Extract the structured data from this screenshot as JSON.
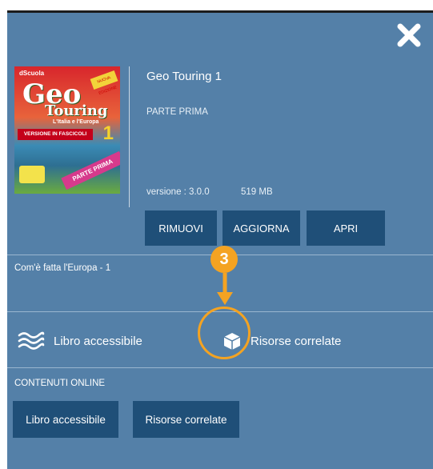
{
  "product": {
    "title": "Geo Touring 1",
    "subtitle": "PARTE PRIMA",
    "version": "versione : 3.0.0",
    "size": "519 MB"
  },
  "cover": {
    "brand": "dScuola",
    "badge": "NUOVA EDIZIONE",
    "title_geo": "Geo",
    "title_touring": "Touring",
    "tagline": "L'Italia e l'Europa",
    "fasc_label": "VERSIONE IN FASCICOLI",
    "number": "1",
    "parte_label": "PARTE PRIMA"
  },
  "actions": {
    "remove": "RIMUOVI",
    "update": "AGGIORNA",
    "open": "APRI"
  },
  "section_title": "Com'è fatta l'Europa - 1",
  "resources": {
    "accessible_book": "Libro accessibile",
    "related_resources": "Risorse correlate"
  },
  "online": {
    "heading": "CONTENUTI ONLINE",
    "accessible_book": "Libro accessibile",
    "related_resources": "Risorse correlate"
  },
  "annotation": {
    "number": "3",
    "color": "#f4a322"
  },
  "colors": {
    "panel": "#5480a8",
    "button": "#1f4f78",
    "text": "#ffffff"
  },
  "icons": {
    "close": "close-x-icon",
    "accessible": "waves-icon",
    "related": "cube-icon"
  }
}
